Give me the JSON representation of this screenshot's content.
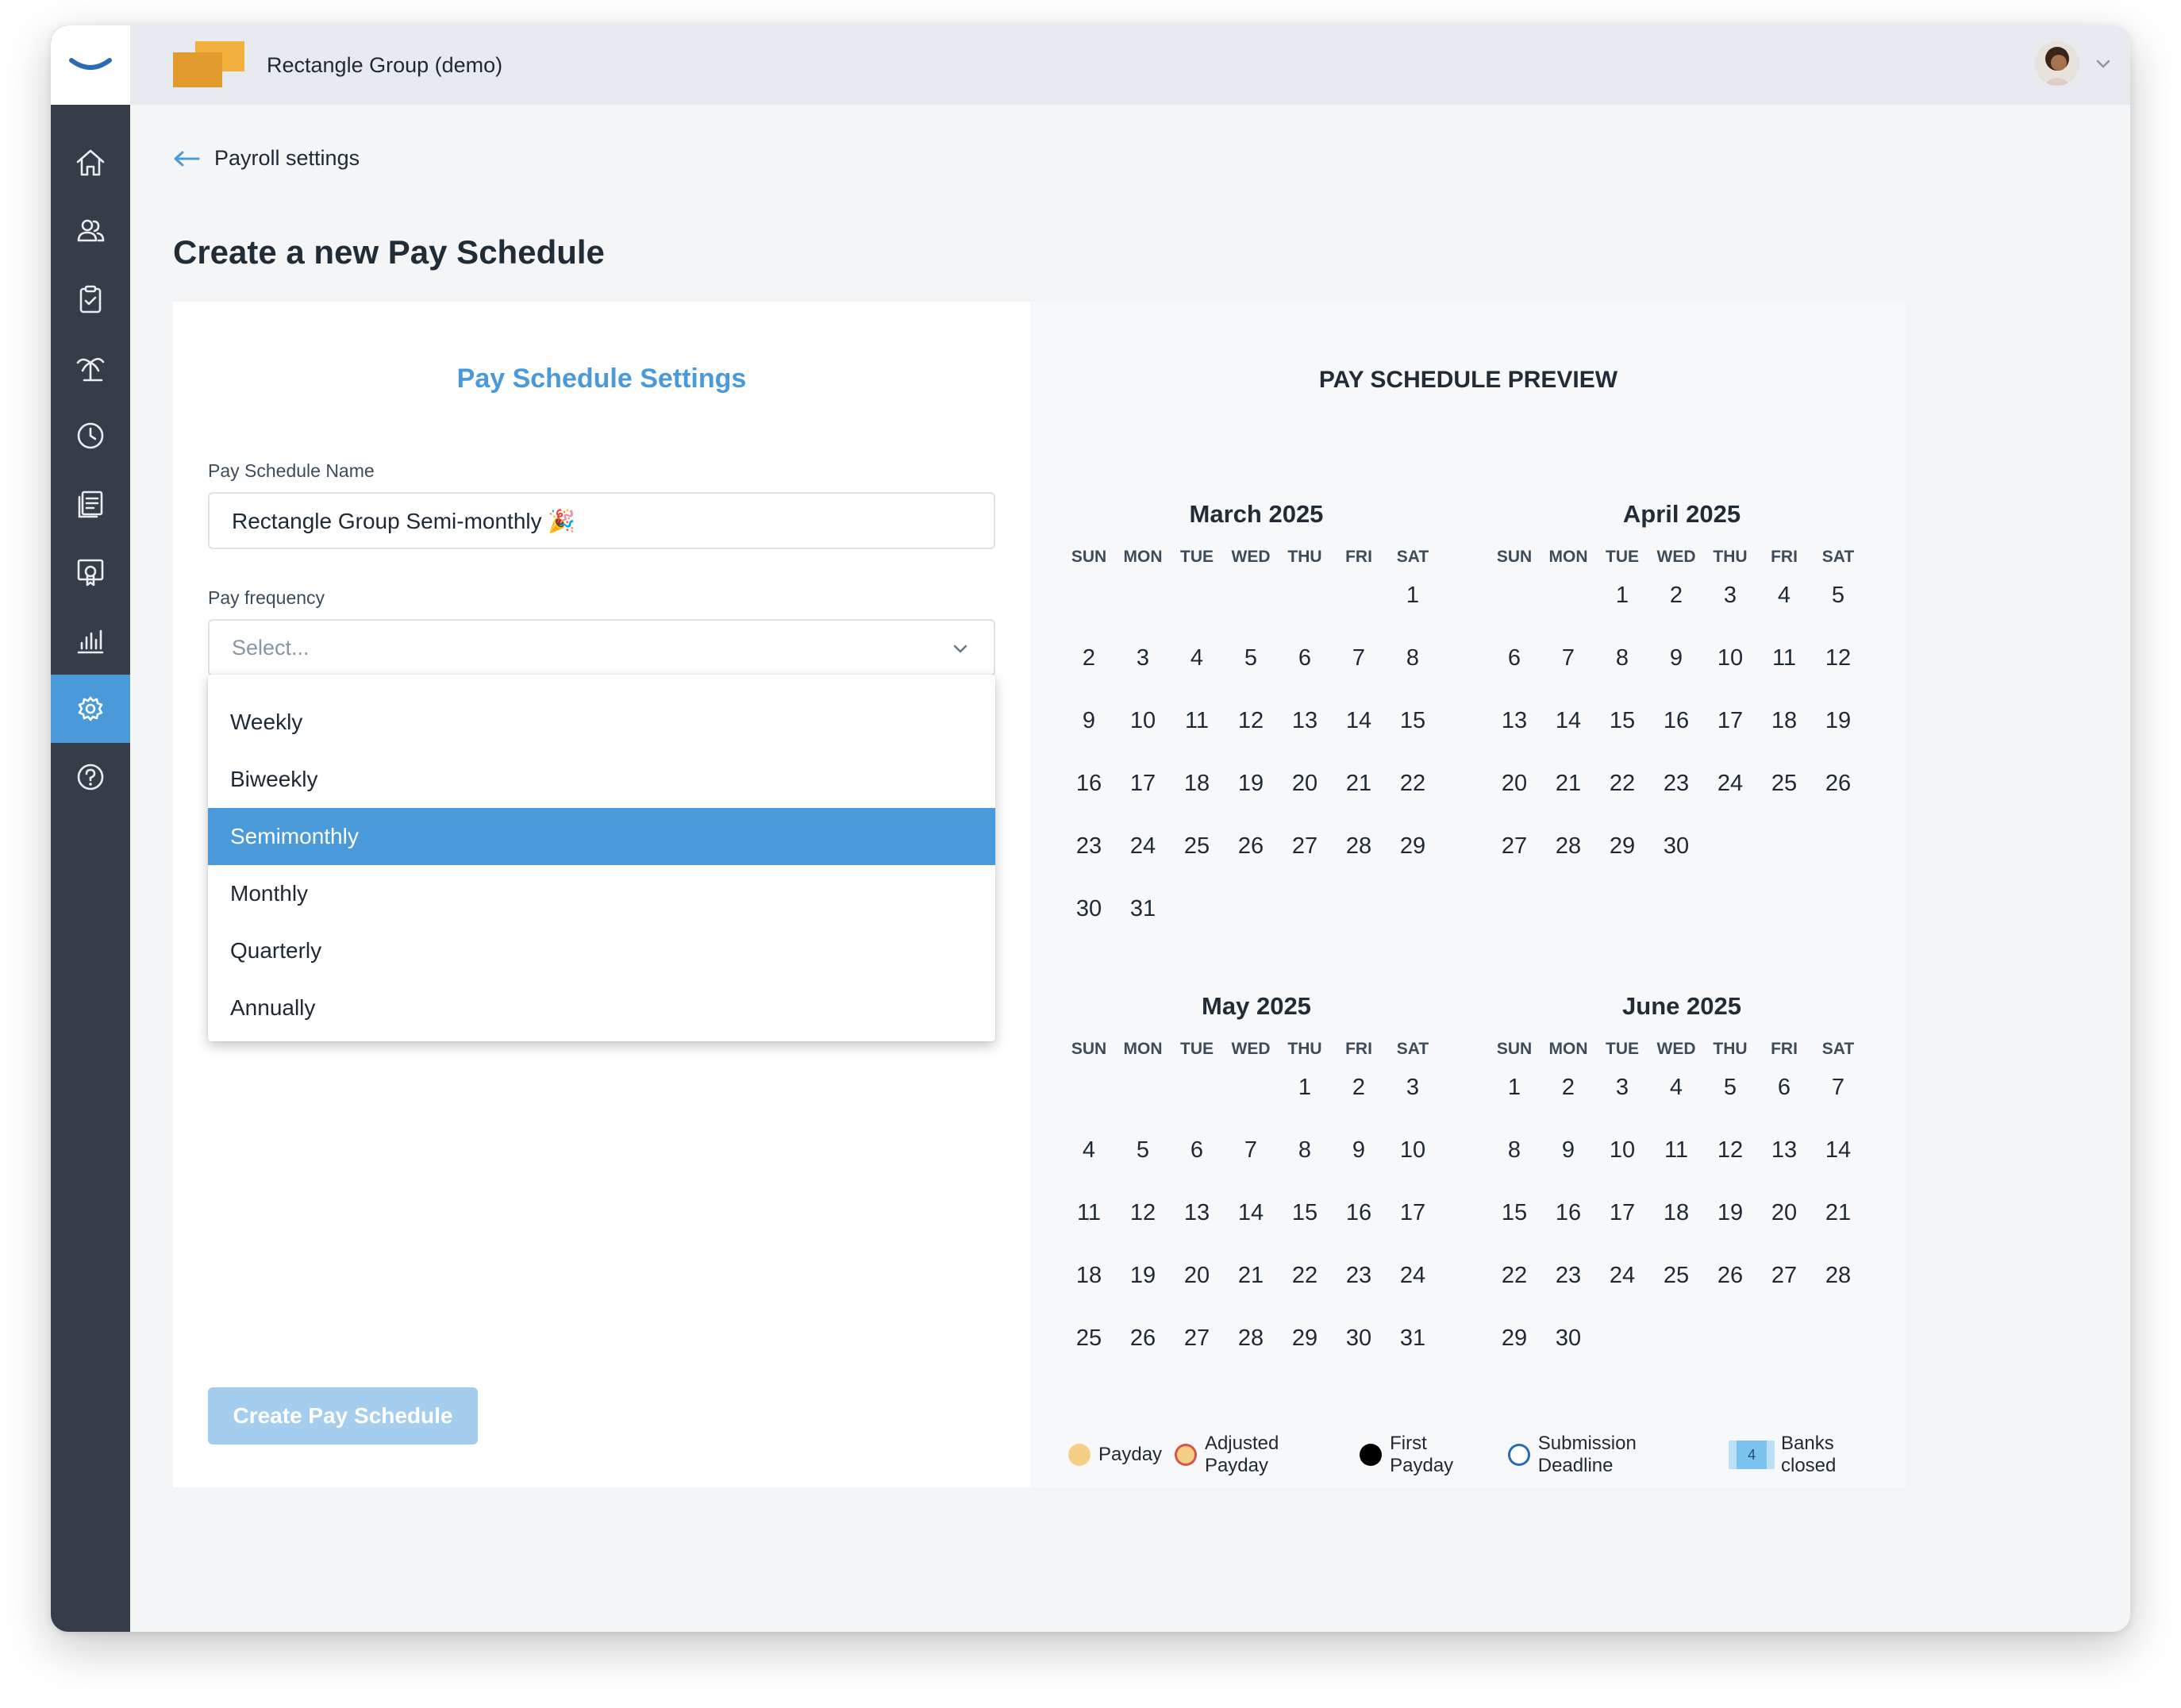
{
  "header": {
    "company_name": "Rectangle Group (demo)"
  },
  "sidebar": {
    "items": [
      {
        "name": "home",
        "icon": "home-icon"
      },
      {
        "name": "people",
        "icon": "people-icon"
      },
      {
        "name": "tasks",
        "icon": "clipboard-icon"
      },
      {
        "name": "time-off",
        "icon": "palm-tree-icon"
      },
      {
        "name": "time",
        "icon": "clock-icon"
      },
      {
        "name": "documents",
        "icon": "documents-icon"
      },
      {
        "name": "training",
        "icon": "certificate-icon"
      },
      {
        "name": "reports",
        "icon": "bar-chart-icon"
      },
      {
        "name": "settings",
        "icon": "gear-icon",
        "active": true
      },
      {
        "name": "help",
        "icon": "help-icon"
      }
    ]
  },
  "breadcrumb": {
    "back_label": "Payroll settings"
  },
  "page": {
    "title": "Create a new Pay Schedule"
  },
  "settings": {
    "title": "Pay Schedule Settings",
    "name_label": "Pay Schedule Name",
    "name_value": "Rectangle Group Semi-monthly 🎉",
    "frequency_label": "Pay frequency",
    "frequency_placeholder": "Select...",
    "frequency_options": [
      "Weekly",
      "Biweekly",
      "Semimonthly",
      "Monthly",
      "Quarterly",
      "Annually"
    ],
    "highlighted_option": "Semimonthly",
    "create_button": "Create Pay Schedule"
  },
  "preview": {
    "title": "PAY SCHEDULE PREVIEW",
    "weekdays": [
      "SUN",
      "MON",
      "TUE",
      "WED",
      "THU",
      "FRI",
      "SAT"
    ],
    "months": [
      {
        "title": "March 2025",
        "first_weekday": 6,
        "days": 31
      },
      {
        "title": "April 2025",
        "first_weekday": 2,
        "days": 30
      },
      {
        "title": "May 2025",
        "first_weekday": 4,
        "days": 31
      },
      {
        "title": "June 2025",
        "first_weekday": 0,
        "days": 30
      }
    ],
    "legend": {
      "payday": "Payday",
      "adjusted_payday": "Adjusted Payday",
      "first_payday": "First Payday",
      "submission_deadline": "Submission Deadline",
      "banks_closed_sample": "4",
      "banks_closed": "Banks closed"
    }
  },
  "colors": {
    "accent": "#4a9ad9",
    "sidebar": "#343d48",
    "button_disabled": "#a4cdee"
  }
}
